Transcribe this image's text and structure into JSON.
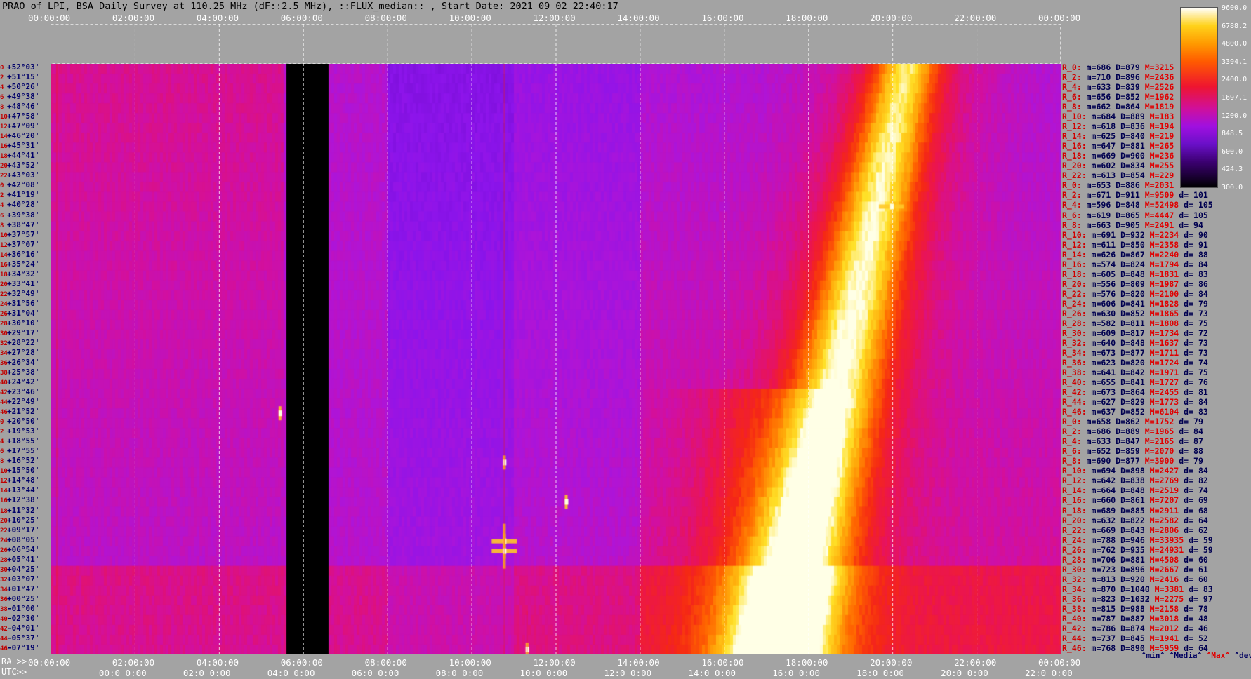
{
  "title": "PRAO of LPI, BSA Daily Survey at 110.25 MHz (dF::2.5 MHz), ::FLUX_median:: , Start Date: 2021 09 02 22:40:17",
  "top_axis_ticks": [
    "00:00:00",
    "02:00:00",
    "04:00:00",
    "06:00:00",
    "08:00:00",
    "10:00:00",
    "12:00:00",
    "14:00:00",
    "16:00:00",
    "18:00:00",
    "20:00:00",
    "22:00:00",
    "00:00:00"
  ],
  "ra_label": "RA >>",
  "utc_label": "UTC>>",
  "ra_ticks": [
    "00:00:00",
    "02:00:00",
    "04:00:00",
    "06:00:00",
    "08:00:00",
    "10:00:00",
    "12:00:00",
    "14:00:00",
    "16:00:00",
    "18:00:00",
    "20:00:00",
    "22:00:00",
    "00:00:00"
  ],
  "utc_ticks": [
    "00:0 0:00",
    "02:0 0:00",
    "04:0 0:00",
    "06:0 0:00",
    "08:0 0:00",
    "10:0 0:00",
    "12:0 0:00",
    "14:0 0:00",
    "16:0 0:00",
    "18:0 0:00",
    "20:0 0:00",
    "22:0 0:00"
  ],
  "colorbar": {
    "labels": [
      "9600.0",
      "6788.2",
      "4800.0",
      "3394.1",
      "2400.0",
      "1697.1",
      "1200.0",
      "848.5",
      "600.0",
      "424.3",
      "300.0"
    ],
    "colors": [
      "#000000",
      "#3b0070",
      "#6a10c8",
      "#a010e0",
      "#d0109a",
      "#ee1530",
      "#ff5a00",
      "#ff9a00",
      "#ffd21a",
      "#ffffff"
    ]
  },
  "footer": {
    "min": "^min^",
    "median": "^Media^",
    "max": "^Max^",
    "devia": "^devia^"
  },
  "chart_data": {
    "type": "heatmap",
    "title": "PRAO of LPI, BSA Daily Survey at 110.25 MHz (dF::2.5 MHz), ::FLUX_median:: , Start Date: 2021 09 02 22:40:17",
    "x_axis": "RA / UTC (hours)",
    "x_range": [
      0,
      24
    ],
    "zscale": "log",
    "zlim": [
      300.0,
      9600.0
    ],
    "gap_ra_hours": [
      5.55,
      6.55
    ],
    "declination_labels": [
      "+52°03'",
      "+51°15'",
      "+50°26'",
      "+49°38'",
      "+48°46'",
      "+47°58'",
      "+47°09'",
      "+46°20'",
      "+45°31'",
      "+44°41'",
      "+43°52'",
      "+43°03'",
      "+42°08'",
      "+41°19'",
      "+40°28'",
      "+39°38'",
      "+38°47'",
      "+37°57'",
      "+37°07'",
      "+36°16'",
      "+35°24'",
      "+34°32'",
      "+33°41'",
      "+32°49'",
      "+31°56'",
      "+31°04'",
      "+30°10'",
      "+29°17'",
      "+28°22'",
      "+27°28'",
      "+26°34'",
      "+25°38'",
      "+24°42'",
      "+23°46'",
      "+22°49'",
      "+21°52'",
      "+20°50'",
      "+19°53'",
      "+18°55'",
      "+17°55'",
      "+16°52'",
      "+15°50'",
      "+14°48'",
      "+13°44'",
      "+12°38'",
      "+11°32'",
      "+10°25'",
      "+09°17'",
      "+08°05'",
      "+06°54'",
      "+05°41'",
      "+04°25'",
      "+03°07'",
      "+01°47'",
      "+00°25'",
      "-01°00'",
      "-02°30'",
      "-04°01'",
      "-05°37'",
      "-07°19'"
    ],
    "row_indices": [
      "0",
      "2",
      "4",
      "6",
      "8",
      "10",
      "12",
      "14",
      "16",
      "18",
      "20",
      "22",
      "0",
      "2",
      "4",
      "6",
      "8",
      "10",
      "12",
      "14",
      "16",
      "18",
      "20",
      "22",
      "24",
      "26",
      "28",
      "30",
      "32",
      "34",
      "36",
      "38",
      "40",
      "42",
      "44",
      "46",
      "0",
      "2",
      "4",
      "6",
      "8",
      "10",
      "12",
      "14",
      "16",
      "18",
      "20",
      "22",
      "24",
      "26",
      "28",
      "30",
      "32",
      "34",
      "36",
      "38",
      "40",
      "42",
      "44",
      "46"
    ],
    "stats": [
      {
        "r": "R_0:",
        "min": "686",
        "med": "879",
        "max": "3215",
        "d": ""
      },
      {
        "r": "R_2:",
        "min": "710",
        "med": "896",
        "max": "2436",
        "d": ""
      },
      {
        "r": "R_4:",
        "min": "633",
        "med": "839",
        "max": "2526",
        "d": ""
      },
      {
        "r": "R_6:",
        "min": "656",
        "med": "852",
        "max": "1962",
        "d": ""
      },
      {
        "r": "R_8:",
        "min": "662",
        "med": "864",
        "max": "1819",
        "d": ""
      },
      {
        "r": "R_10:",
        "min": "684",
        "med": "889",
        "max": "183",
        "d": ""
      },
      {
        "r": "R_12:",
        "min": "618",
        "med": "836",
        "max": "194",
        "d": ""
      },
      {
        "r": "R_14:",
        "min": "625",
        "med": "840",
        "max": "219",
        "d": ""
      },
      {
        "r": "R_16:",
        "min": "647",
        "med": "881",
        "max": "265",
        "d": ""
      },
      {
        "r": "R_18:",
        "min": "669",
        "med": "900",
        "max": "236",
        "d": ""
      },
      {
        "r": "R_20:",
        "min": "602",
        "med": "834",
        "max": "255",
        "d": ""
      },
      {
        "r": "R_22:",
        "min": "613",
        "med": "854",
        "max": "229",
        "d": ""
      },
      {
        "r": "R_0:",
        "min": "653",
        "med": "886",
        "max": "2031",
        "d": ""
      },
      {
        "r": "R_2:",
        "min": "671",
        "med": "911",
        "max": "9509",
        "d": "101"
      },
      {
        "r": "R_4:",
        "min": "596",
        "med": "848",
        "max": "52498",
        "d": "105"
      },
      {
        "r": "R_6:",
        "min": "619",
        "med": "865",
        "max": "4447",
        "d": "105"
      },
      {
        "r": "R_8:",
        "min": "663",
        "med": "905",
        "max": "2491",
        "d": "94"
      },
      {
        "r": "R_10:",
        "min": "691",
        "med": "932",
        "max": "2234",
        "d": "90"
      },
      {
        "r": "R_12:",
        "min": "611",
        "med": "850",
        "max": "2358",
        "d": "91"
      },
      {
        "r": "R_14:",
        "min": "626",
        "med": "867",
        "max": "2240",
        "d": "88"
      },
      {
        "r": "R_16:",
        "min": "574",
        "med": "824",
        "max": "1794",
        "d": "84"
      },
      {
        "r": "R_18:",
        "min": "605",
        "med": "848",
        "max": "1831",
        "d": "83"
      },
      {
        "r": "R_20:",
        "min": "556",
        "med": "809",
        "max": "1987",
        "d": "86"
      },
      {
        "r": "R_22:",
        "min": "576",
        "med": "820",
        "max": "2100",
        "d": "84"
      },
      {
        "r": "R_24:",
        "min": "606",
        "med": "841",
        "max": "1828",
        "d": "79"
      },
      {
        "r": "R_26:",
        "min": "630",
        "med": "852",
        "max": "1865",
        "d": "73"
      },
      {
        "r": "R_28:",
        "min": "582",
        "med": "811",
        "max": "1808",
        "d": "75"
      },
      {
        "r": "R_30:",
        "min": "609",
        "med": "817",
        "max": "1734",
        "d": "72"
      },
      {
        "r": "R_32:",
        "min": "640",
        "med": "848",
        "max": "1637",
        "d": "73"
      },
      {
        "r": "R_34:",
        "min": "673",
        "med": "877",
        "max": "1711",
        "d": "73"
      },
      {
        "r": "R_36:",
        "min": "623",
        "med": "820",
        "max": "1724",
        "d": "74"
      },
      {
        "r": "R_38:",
        "min": "641",
        "med": "842",
        "max": "1971",
        "d": "75"
      },
      {
        "r": "R_40:",
        "min": "655",
        "med": "841",
        "max": "1727",
        "d": "76"
      },
      {
        "r": "R_42:",
        "min": "673",
        "med": "864",
        "max": "2455",
        "d": "81"
      },
      {
        "r": "R_44:",
        "min": "627",
        "med": "829",
        "max": "1773",
        "d": "84"
      },
      {
        "r": "R_46:",
        "min": "637",
        "med": "852",
        "max": "6104",
        "d": "83"
      },
      {
        "r": "R_0:",
        "min": "658",
        "med": "862",
        "max": "1752",
        "d": "79"
      },
      {
        "r": "R_2:",
        "min": "686",
        "med": "889",
        "max": "1965",
        "d": "84"
      },
      {
        "r": "R_4:",
        "min": "633",
        "med": "847",
        "max": "2165",
        "d": "87"
      },
      {
        "r": "R_6:",
        "min": "652",
        "med": "859",
        "max": "2070",
        "d": "88"
      },
      {
        "r": "R_8:",
        "min": "690",
        "med": "877",
        "max": "3900",
        "d": "79"
      },
      {
        "r": "R_10:",
        "min": "694",
        "med": "898",
        "max": "2427",
        "d": "84"
      },
      {
        "r": "R_12:",
        "min": "642",
        "med": "838",
        "max": "2769",
        "d": "82"
      },
      {
        "r": "R_14:",
        "min": "664",
        "med": "848",
        "max": "2519",
        "d": "74"
      },
      {
        "r": "R_16:",
        "min": "660",
        "med": "861",
        "max": "7207",
        "d": "69"
      },
      {
        "r": "R_18:",
        "min": "689",
        "med": "885",
        "max": "2911",
        "d": "68"
      },
      {
        "r": "R_20:",
        "min": "632",
        "med": "822",
        "max": "2582",
        "d": "64"
      },
      {
        "r": "R_22:",
        "min": "669",
        "med": "843",
        "max": "2806",
        "d": "62"
      },
      {
        "r": "R_24:",
        "min": "788",
        "med": "946",
        "max": "33935",
        "d": "59"
      },
      {
        "r": "R_26:",
        "min": "762",
        "med": "935",
        "max": "24931",
        "d": "59"
      },
      {
        "r": "R_28:",
        "min": "706",
        "med": "881",
        "max": "4508",
        "d": "60"
      },
      {
        "r": "R_30:",
        "min": "723",
        "med": "896",
        "max": "2667",
        "d": "61"
      },
      {
        "r": "R_32:",
        "min": "813",
        "med": "920",
        "max": "2416",
        "d": "60"
      },
      {
        "r": "R_34:",
        "min": "870",
        "med": "1040",
        "max": "3381",
        "d": "83"
      },
      {
        "r": "R_36:",
        "min": "823",
        "med": "1032",
        "max": "2275",
        "d": "97"
      },
      {
        "r": "R_38:",
        "min": "815",
        "med": "988",
        "max": "2158",
        "d": "78"
      },
      {
        "r": "R_40:",
        "min": "787",
        "med": "887",
        "max": "3018",
        "d": "48"
      },
      {
        "r": "R_42:",
        "min": "786",
        "med": "874",
        "max": "2012",
        "d": "46"
      },
      {
        "r": "R_44:",
        "min": "737",
        "med": "845",
        "max": "1941",
        "d": "52"
      },
      {
        "r": "R_46:",
        "min": "768",
        "med": "890",
        "max": "5959",
        "d": "64"
      }
    ],
    "bright_sources": [
      {
        "ra_h": 19.98,
        "row": 14,
        "flux": 52498
      },
      {
        "ra_h": 10.78,
        "row": 48,
        "flux": 33935
      },
      {
        "ra_h": 10.78,
        "row": 49,
        "flux": 24931
      },
      {
        "ra_h": 12.25,
        "row": 44,
        "flux": 7207
      },
      {
        "ra_h": 10.78,
        "row": 40,
        "flux": 3900
      },
      {
        "ra_h": 11.32,
        "row": 59,
        "flux": 5959
      },
      {
        "ra_h": 5.45,
        "row": 35,
        "flux": 6104
      }
    ]
  }
}
